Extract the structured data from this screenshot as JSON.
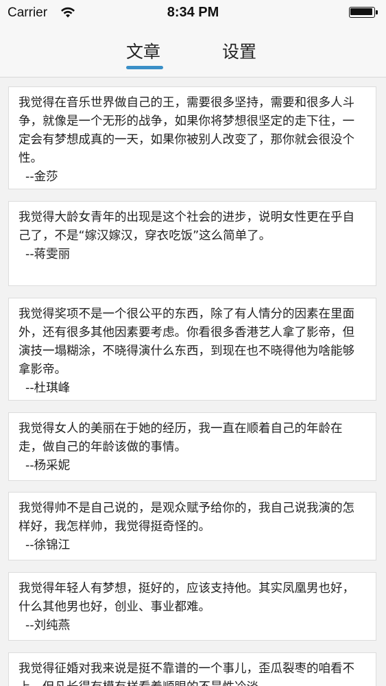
{
  "status_bar": {
    "carrier": "Carrier",
    "time": "8:34 PM",
    "wifi_icon": "wifi-icon",
    "battery_icon": "battery-icon"
  },
  "tabs": [
    {
      "label": "文章",
      "active": true
    },
    {
      "label": "设置",
      "active": false
    }
  ],
  "colors": {
    "accent": "#3a8fc7",
    "bar_bg": "#f7f7f7",
    "list_bg": "#f2f2f2"
  },
  "articles": [
    {
      "quote": "我觉得在音乐世界做自己的王，需要很多坚持，需要和很多人斗争，就像是一个无形的战争，如果你将梦想很坚定的走下往，一定会有梦想成真的一天，如果你被别人改变了，那你就会很没个性。",
      "author": "--金莎"
    },
    {
      "quote": "我觉得大龄女青年的出现是这个社会的进步，说明女性更在乎自己了，不是“嫁汉嫁汉，穿衣吃饭”这么简单了。",
      "author": "--蒋雯丽"
    },
    {
      "quote": "我觉得奖项不是一个很公平的东西，除了有人情分的因素在里面外，还有很多其他因素要考虑。你看很多香港艺人拿了影帝，但演技一塌糊涂，不晓得演什么东西，到现在也不晓得他为啥能够拿影帝。",
      "author": "--杜琪峰"
    },
    {
      "quote": "我觉得女人的美丽在于她的经历，我一直在顺着自己的年龄在走，做自己的年龄该做的事情。",
      "author": "--杨采妮"
    },
    {
      "quote": "我觉得帅不是自己说的，是观众赋予给你的，我自己说我演的怎样好，我怎样帅，我觉得挺奇怪的。",
      "author": "--徐锦江"
    },
    {
      "quote": "我觉得年轻人有梦想，挺好的，应该支持他。其实凤凰男也好，什么其他男也好，创业、事业都难。",
      "author": "--刘纯燕"
    },
    {
      "quote": "我觉得征婚对我来说是挺不靠谱的一个事儿，歪瓜裂枣的咱看不上，但凡长得有模有样看着顺眼的不是性冷淡",
      "author": ""
    }
  ]
}
